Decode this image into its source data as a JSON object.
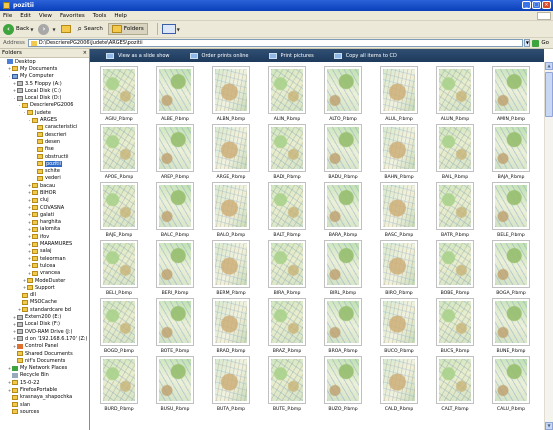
{
  "window": {
    "title": "pozitii"
  },
  "menu": [
    "File",
    "Edit",
    "View",
    "Favorites",
    "Tools",
    "Help"
  ],
  "toolbar": {
    "back": "Back",
    "search": "Search",
    "folders": "Folders"
  },
  "address": {
    "label": "Address",
    "path": "D:\\DescrierePG2006\\Judete\\ARGES\\pozitii",
    "go": "Go"
  },
  "folders_pane": {
    "title": "Folders",
    "items": [
      {
        "label": "Desktop",
        "icon": "desk",
        "indent": 0,
        "exp": ""
      },
      {
        "label": "My Documents",
        "icon": "folder",
        "indent": 1,
        "exp": "+"
      },
      {
        "label": "My Computer",
        "icon": "comp",
        "indent": 1,
        "exp": "-"
      },
      {
        "label": "3.5 Floppy (A:)",
        "icon": "drive",
        "indent": 2,
        "exp": "+"
      },
      {
        "label": "Local Disk (C:)",
        "icon": "drive",
        "indent": 2,
        "exp": "+"
      },
      {
        "label": "Local Disk (D:)",
        "icon": "drive",
        "indent": 2,
        "exp": "-"
      },
      {
        "label": "DescrierePG2006",
        "icon": "folder",
        "indent": 3,
        "exp": "-"
      },
      {
        "label": "Judete",
        "icon": "folder",
        "indent": 4,
        "exp": "-"
      },
      {
        "label": "ARGES",
        "icon": "folder",
        "indent": 5,
        "exp": "-"
      },
      {
        "label": "caracteristici",
        "icon": "folder",
        "indent": 6,
        "exp": ""
      },
      {
        "label": "descrieri",
        "icon": "folder",
        "indent": 6,
        "exp": ""
      },
      {
        "label": "desen",
        "icon": "folder",
        "indent": 6,
        "exp": ""
      },
      {
        "label": "fise",
        "icon": "folder",
        "indent": 6,
        "exp": ""
      },
      {
        "label": "obstructii",
        "icon": "folder",
        "indent": 6,
        "exp": ""
      },
      {
        "label": "pozitii",
        "icon": "folder",
        "indent": 6,
        "exp": "",
        "selected": true
      },
      {
        "label": "schite",
        "icon": "folder",
        "indent": 6,
        "exp": ""
      },
      {
        "label": "vederi",
        "icon": "folder",
        "indent": 6,
        "exp": ""
      },
      {
        "label": "bacau",
        "icon": "folder",
        "indent": 5,
        "exp": "+"
      },
      {
        "label": "BIHOR",
        "icon": "folder",
        "indent": 5,
        "exp": "+"
      },
      {
        "label": "cluj",
        "icon": "folder",
        "indent": 5,
        "exp": "+"
      },
      {
        "label": "COVASNA",
        "icon": "folder",
        "indent": 5,
        "exp": "+"
      },
      {
        "label": "galati",
        "icon": "folder",
        "indent": 5,
        "exp": "+"
      },
      {
        "label": "harghita",
        "icon": "folder",
        "indent": 5,
        "exp": "+"
      },
      {
        "label": "ialomita",
        "icon": "folder",
        "indent": 5,
        "exp": "+"
      },
      {
        "label": "ifov",
        "icon": "folder",
        "indent": 5,
        "exp": "+"
      },
      {
        "label": "MARAMURES",
        "icon": "folder",
        "indent": 5,
        "exp": "+"
      },
      {
        "label": "salaj",
        "icon": "folder",
        "indent": 5,
        "exp": "+"
      },
      {
        "label": "teleorman",
        "icon": "folder",
        "indent": 5,
        "exp": "+"
      },
      {
        "label": "tulcea",
        "icon": "folder",
        "indent": 5,
        "exp": "+"
      },
      {
        "label": "vrancea",
        "icon": "folder",
        "indent": 5,
        "exp": "+"
      },
      {
        "label": "ModeDuster",
        "icon": "folder",
        "indent": 4,
        "exp": "+"
      },
      {
        "label": "Support",
        "icon": "folder",
        "indent": 4,
        "exp": "+"
      },
      {
        "label": "dll",
        "icon": "folder",
        "indent": 3,
        "exp": ""
      },
      {
        "label": "MSOCache",
        "icon": "folder",
        "indent": 3,
        "exp": ""
      },
      {
        "label": "standardcare bd",
        "icon": "folder",
        "indent": 3,
        "exp": "+"
      },
      {
        "label": "Extern200 (E:)",
        "icon": "drive",
        "indent": 2,
        "exp": "+"
      },
      {
        "label": "Local Disk (F:)",
        "icon": "drive",
        "indent": 2,
        "exp": "+"
      },
      {
        "label": "DVD-RAM Drive (J:)",
        "icon": "drive",
        "indent": 2,
        "exp": "+"
      },
      {
        "label": "d on '192.168.6.170' (Z:)",
        "icon": "drive",
        "indent": 2,
        "exp": "+"
      },
      {
        "label": "Control Panel",
        "icon": "cp",
        "indent": 2,
        "exp": "+"
      },
      {
        "label": "Shared Documents",
        "icon": "folder",
        "indent": 2,
        "exp": ""
      },
      {
        "label": "nif's Documents",
        "icon": "folder",
        "indent": 2,
        "exp": ""
      },
      {
        "label": "My Network Places",
        "icon": "net",
        "indent": 1,
        "exp": "+"
      },
      {
        "label": "Recycle Bin",
        "icon": "bin",
        "indent": 1,
        "exp": ""
      },
      {
        "label": "15-0-22",
        "icon": "folder",
        "indent": 1,
        "exp": "+"
      },
      {
        "label": "FirefoxPortable",
        "icon": "folder",
        "indent": 1,
        "exp": "+"
      },
      {
        "label": "krasnaya_shapochka",
        "icon": "folder",
        "indent": 1,
        "exp": ""
      },
      {
        "label": "slan",
        "icon": "folder",
        "indent": 1,
        "exp": ""
      },
      {
        "label": "sources",
        "icon": "folder",
        "indent": 1,
        "exp": ""
      }
    ]
  },
  "tasks": [
    "View as a slide show",
    "Order prints online",
    "Print pictures",
    "Copy all items to CD"
  ],
  "files": [
    "AGIU_P.bmp",
    "ALBE_P.bmp",
    "ALBN_P.bmp",
    "ALIN_P.bmp",
    "ALTO_P.bmp",
    "ALUL_P.bmp",
    "ALUN_P.bmp",
    "AMIN_P.bmp",
    "APOE_P.bmp",
    "AREP_P.bmp",
    "ARGE_P.bmp",
    "BADI_P.bmp",
    "BADU_P.bmp",
    "BAHN_P.bmp",
    "BAIL_P.bmp",
    "BAJA_P.bmp",
    "BAJE_P.bmp",
    "BALC_P.bmp",
    "BALO_P.bmp",
    "BALT_P.bmp",
    "BARA_P.bmp",
    "BASC_P.bmp",
    "BATR_P.bmp",
    "BELE_P.bmp",
    "BELI_P.bmp",
    "BERI_P.bmp",
    "BERM_P.bmp",
    "BIRA_P.bmp",
    "BIRL_P.bmp",
    "BIRO_P.bmp",
    "BOBE_P.bmp",
    "BOGA_P.bmp",
    "BOGD_P.bmp",
    "BOTE_P.bmp",
    "BRAD_P.bmp",
    "BRAZ_P.bmp",
    "BROA_P.bmp",
    "BUCO_P.bmp",
    "BUCS_P.bmp",
    "BUNE_P.bmp",
    "BURD_P.bmp",
    "BUSU_P.bmp",
    "BUTA_P.bmp",
    "BUTE_P.bmp",
    "BUZO_P.bmp",
    "CALD_P.bmp",
    "CALT_P.bmp",
    "CALU_P.bmp"
  ]
}
